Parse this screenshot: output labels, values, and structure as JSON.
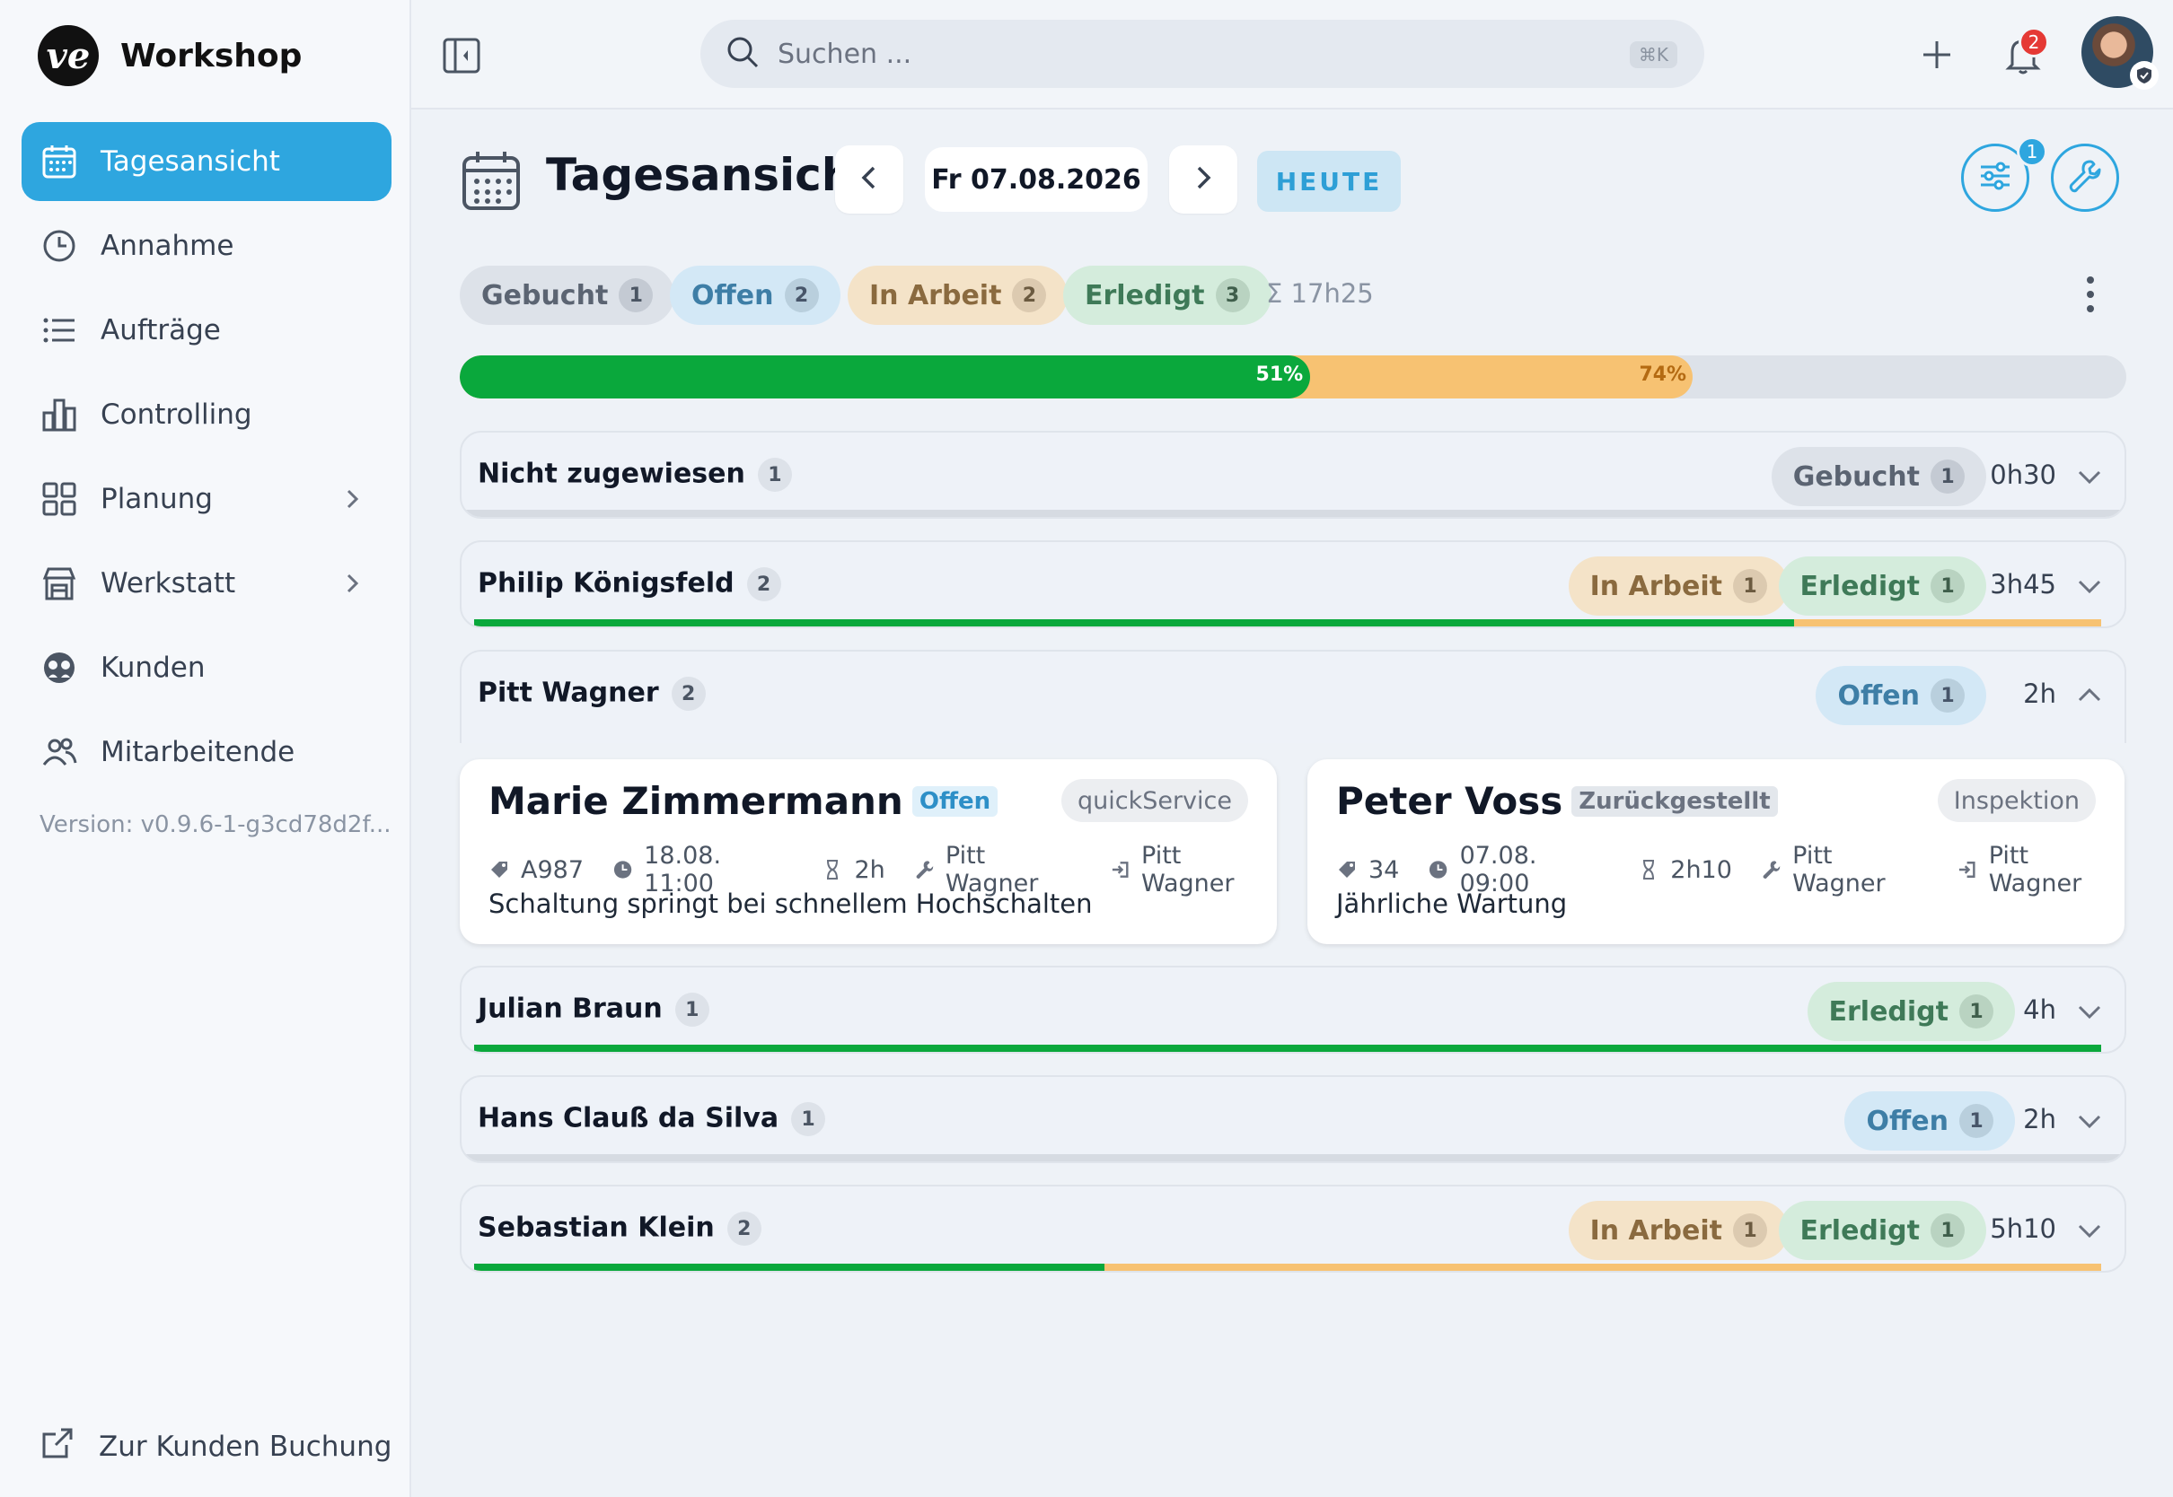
{
  "brand": {
    "name": "Workshop",
    "logo_text": "ve"
  },
  "sidebar": {
    "items": [
      {
        "label": "Tagesansicht",
        "icon": "calendar-icon",
        "active": true
      },
      {
        "label": "Annahme",
        "icon": "clock-icon"
      },
      {
        "label": "Aufträge",
        "icon": "list-icon"
      },
      {
        "label": "Controlling",
        "icon": "bar-chart-icon"
      },
      {
        "label": "Planung",
        "icon": "grid-icon",
        "has_submenu": true
      },
      {
        "label": "Werkstatt",
        "icon": "store-icon",
        "has_submenu": true
      },
      {
        "label": "Kunden",
        "icon": "users-circle-icon"
      },
      {
        "label": "Mitarbeitende",
        "icon": "people-icon"
      }
    ],
    "version": "Version: v0.9.6-1-g3cd78d2f...",
    "bottom_link": "Zur Kunden Buchung"
  },
  "topbar": {
    "search_placeholder": "Suchen ...",
    "search_shortcut": "⌘K",
    "notification_count": "2"
  },
  "header": {
    "title": "Tagesansicht",
    "date": "Fr 07.08.2026",
    "today_label": "HEUTE",
    "filter_badge": "1"
  },
  "summary": {
    "chips": [
      {
        "label": "Gebucht",
        "count": "1"
      },
      {
        "label": "Offen",
        "count": "2"
      },
      {
        "label": "In Arbeit",
        "count": "2"
      },
      {
        "label": "Erledigt",
        "count": "3"
      }
    ],
    "total": "Σ 17h25"
  },
  "progress": {
    "done_percent": 51,
    "in_progress_percent": 74,
    "done_label": "51%",
    "in_progress_label": "74%"
  },
  "groups": [
    {
      "name": "Nicht zugewiesen",
      "count": "1",
      "chips": [
        {
          "label": "Gebucht",
          "count": "1",
          "kind": "gebucht"
        }
      ],
      "time": "0h30",
      "expanded": false
    },
    {
      "name": "Philip Königsfeld",
      "count": "2",
      "chips": [
        {
          "label": "In Arbeit",
          "count": "1",
          "kind": "arbeit"
        },
        {
          "label": "Erledigt",
          "count": "1",
          "kind": "erledigt"
        }
      ],
      "time": "3h45",
      "expanded": false
    },
    {
      "name": "Pitt Wagner",
      "count": "2",
      "chips": [
        {
          "label": "Offen",
          "count": "1",
          "kind": "offen"
        }
      ],
      "time": "2h",
      "expanded": true
    },
    {
      "name": "Julian Braun",
      "count": "1",
      "chips": [
        {
          "label": "Erledigt",
          "count": "1",
          "kind": "erledigt"
        }
      ],
      "time": "4h",
      "expanded": false
    },
    {
      "name": "Hans Clauß da Silva",
      "count": "1",
      "chips": [
        {
          "label": "Offen",
          "count": "1",
          "kind": "offen"
        }
      ],
      "time": "2h",
      "expanded": false
    },
    {
      "name": "Sebastian Klein",
      "count": "2",
      "chips": [
        {
          "label": "In Arbeit",
          "count": "1",
          "kind": "arbeit"
        },
        {
          "label": "Erledigt",
          "count": "1",
          "kind": "erledigt"
        }
      ],
      "time": "5h10",
      "expanded": false
    }
  ],
  "cards": [
    {
      "customer": "Marie Zimmermann",
      "status": "Offen",
      "type": "quickService",
      "tag": "A987",
      "datetime": "18.08. 11:00",
      "duration": "2h",
      "mechanic": "Pitt Wagner",
      "assignee": "Pitt Wagner",
      "description": "Schaltung springt bei schnellem Hochschalten"
    },
    {
      "customer": "Peter Voss",
      "status": "Zurückgestellt",
      "type": "Inspektion",
      "tag": "34",
      "datetime": "07.08. 09:00",
      "duration": "2h10",
      "mechanic": "Pitt Wagner",
      "assignee": "Pitt Wagner",
      "description": "Jährliche Wartung"
    }
  ]
}
